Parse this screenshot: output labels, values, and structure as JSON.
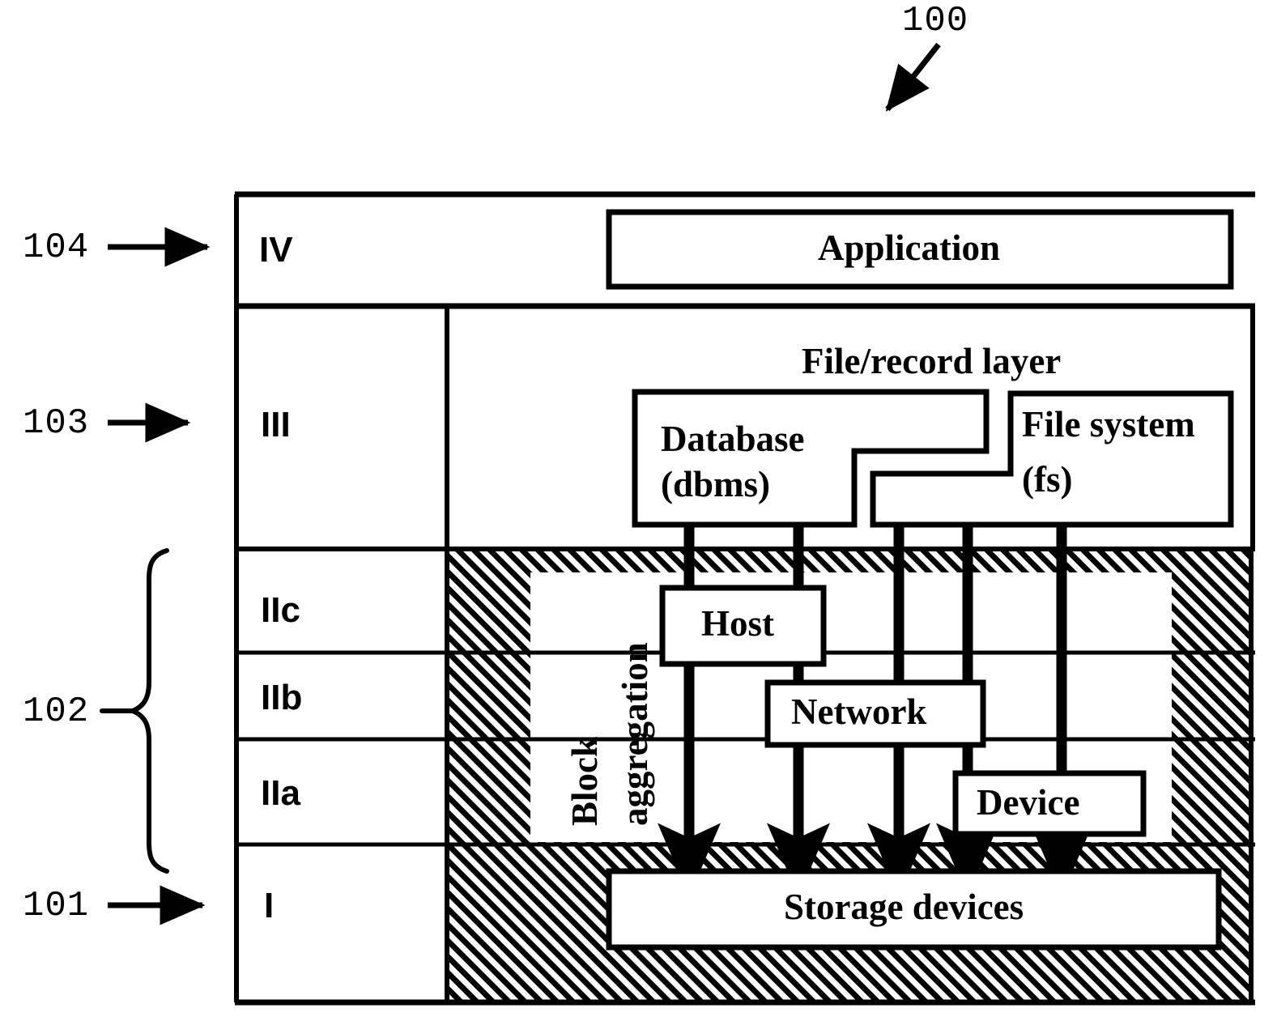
{
  "figure": {
    "reference_numeral": "100",
    "callout_arrow": "diagonal-arrow-down-left"
  },
  "left_labels": [
    {
      "id": "104",
      "number": "104",
      "marker": "arrow",
      "points_to": "IV"
    },
    {
      "id": "103",
      "number": "103",
      "marker": "arrow",
      "points_to": "III"
    },
    {
      "id": "102",
      "number": "102",
      "marker": "curly-brace",
      "points_to": "IIc, IIb, IIa"
    },
    {
      "id": "101",
      "number": "101",
      "marker": "arrow",
      "points_to": "I"
    }
  ],
  "layers": [
    {
      "id": "IV",
      "roman": "IV",
      "name": "application-layer"
    },
    {
      "id": "III",
      "roman": "III",
      "name": "file-record-layer"
    },
    {
      "id": "IIc",
      "roman": "IIc",
      "name": "block-aggregation-host-layer"
    },
    {
      "id": "IIb",
      "roman": "IIb",
      "name": "block-aggregation-network-layer"
    },
    {
      "id": "IIa",
      "roman": "IIa",
      "name": "block-aggregation-device-layer"
    },
    {
      "id": "I",
      "roman": "I",
      "name": "storage-devices-layer"
    }
  ],
  "boxes": {
    "application": "Application",
    "file_record_layer_title": "File/record layer",
    "database": "Database",
    "database_sub": "(dbms)",
    "file_system": "File system",
    "file_system_sub": "(fs)",
    "block_aggregation_word1": "Block",
    "block_aggregation_word2": "aggregation",
    "host": "Host",
    "network": "Network",
    "device": "Device",
    "storage_devices": "Storage devices"
  },
  "colors": {
    "ink": "#000000",
    "paper": "#ffffff",
    "hatch": "#000000"
  },
  "arrows": {
    "count": 5,
    "description": "five thick vertical data-path arrows descending from the file/record layer through the block aggregation region into the storage devices box"
  }
}
